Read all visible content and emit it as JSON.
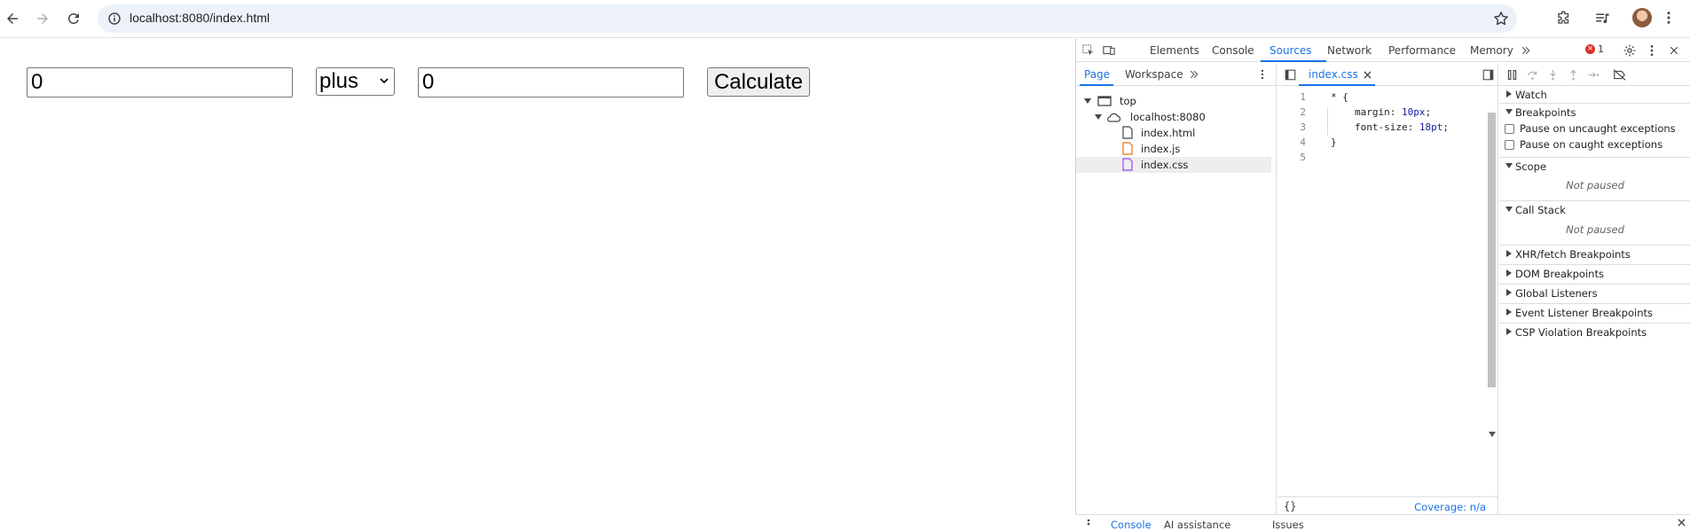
{
  "browser": {
    "url": "localhost:8080/index.html",
    "icons": [
      "back-icon",
      "forward-icon",
      "reload-icon",
      "info-icon",
      "star-icon",
      "extensions-icon",
      "media-icon",
      "avatar",
      "more-icon"
    ]
  },
  "page": {
    "left_value": "0",
    "operator": "plus",
    "right_value": "0",
    "calculate_label": "Calculate"
  },
  "devtools": {
    "tabs": [
      "Elements",
      "Console",
      "Sources",
      "Network",
      "Performance",
      "Memory"
    ],
    "active_tab": "Sources",
    "error_count": "1",
    "navigator": {
      "tabs": [
        "Page",
        "Workspace"
      ],
      "active": "Page",
      "tree": {
        "top": "top",
        "host": "localhost:8080",
        "files": [
          "index.html",
          "index.js",
          "index.css"
        ],
        "selected": "index.css"
      }
    },
    "editor": {
      "tab_label": "index.css",
      "line_numbers": [
        "1",
        "2",
        "3",
        "4",
        "5"
      ],
      "lines": {
        "l1": "* {",
        "l2_prop": "margin: ",
        "l2_val": "10px",
        "l2_end": ";",
        "l3_prop": "font-size: ",
        "l3_val": "18pt",
        "l3_end": ";",
        "l4": "}"
      },
      "footer_braces": "{}",
      "coverage": "Coverage: n/a"
    },
    "debugger": {
      "watch": "Watch",
      "breakpoints": "Breakpoints",
      "pause_uncaught": "Pause on uncaught exceptions",
      "pause_caught": "Pause on caught exceptions",
      "scope": "Scope",
      "scope_status": "Not paused",
      "call_stack": "Call Stack",
      "call_stack_status": "Not paused",
      "xhr": "XHR/fetch Breakpoints",
      "dom": "DOM Breakpoints",
      "global": "Global Listeners",
      "event": "Event Listener Breakpoints",
      "csp": "CSP Violation Breakpoints"
    },
    "drawer": {
      "tabs": [
        "Console",
        "AI assistance",
        "Issues"
      ],
      "active": "Console"
    }
  },
  "colors": {
    "accent": "#1a73e8",
    "error": "#d93025",
    "omnibox": "#edf2fa"
  }
}
